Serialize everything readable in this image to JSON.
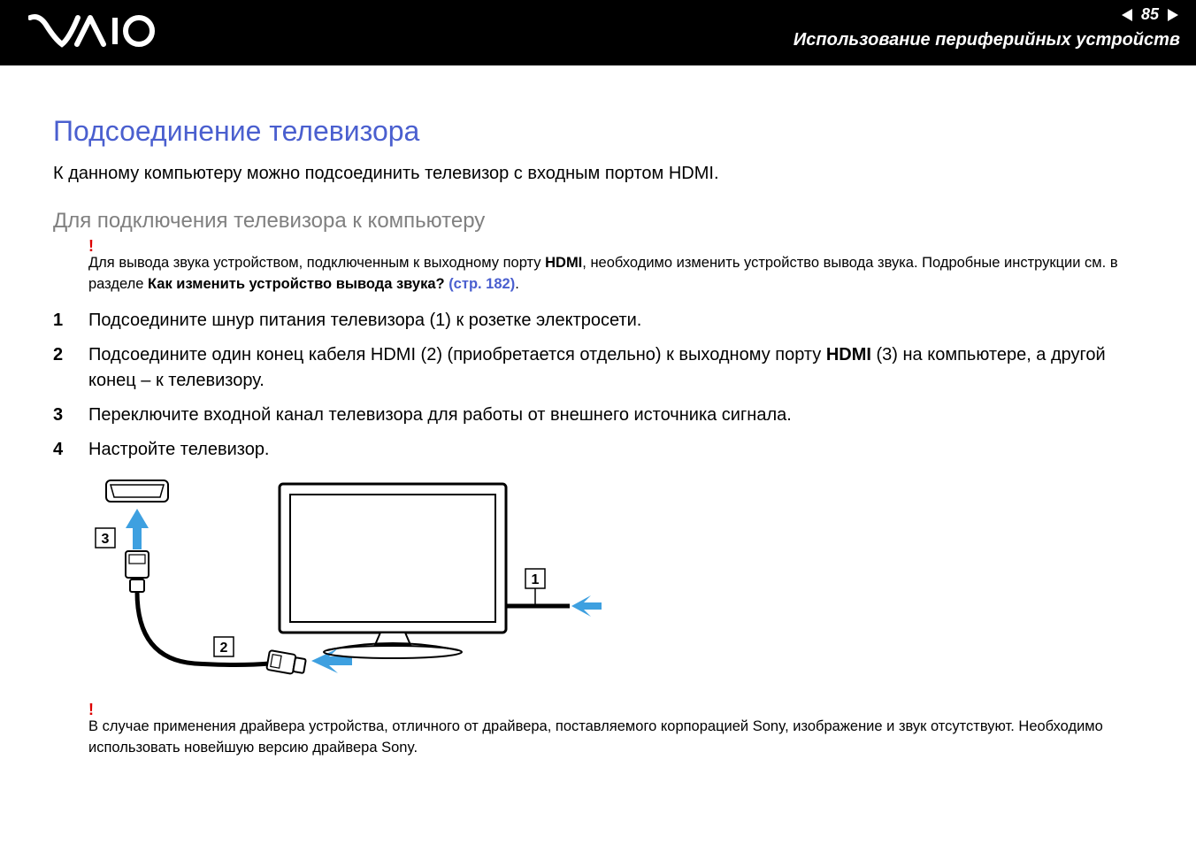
{
  "header": {
    "page_number": "85",
    "section_title": "Использование периферийных устройств"
  },
  "title": "Подсоединение телевизора",
  "intro": "К данному компьютеру можно подсоединить телевизор с входным портом HDMI.",
  "subheading": "Для подключения телевизора к компьютеру",
  "warning1": {
    "mark": "!",
    "text_prefix": "Для вывода звука устройством, подключенным к выходному порту ",
    "bold1": "HDMI",
    "text_mid": ", необходимо изменить устройство вывода звука. Подробные инструкции см. в разделе ",
    "bold2": "Как изменить устройство вывода звука? ",
    "link": "(стр. 182)",
    "suffix": "."
  },
  "steps": {
    "s1": "Подсоедините шнур питания телевизора (1) к розетке электросети.",
    "s2_a": "Подсоедините один конец кабеля HDMI (2) (приобретается отдельно) к выходному порту ",
    "s2_bold": "HDMI",
    "s2_b": " (3) на компьютере, а другой конец – к телевизору.",
    "s3": "Переключите входной канал телевизора для работы от внешнего источника сигнала.",
    "s4": "Настройте телевизор."
  },
  "diagram": {
    "labels": {
      "l1": "1",
      "l2": "2",
      "l3": "3"
    }
  },
  "warning2": {
    "mark": "!",
    "text": "В случае применения драйвера устройства, отличного от драйвера, поставляемого корпорацией Sony, изображение и звук отсутствуют. Необходимо использовать новейшую версию драйвера Sony."
  }
}
